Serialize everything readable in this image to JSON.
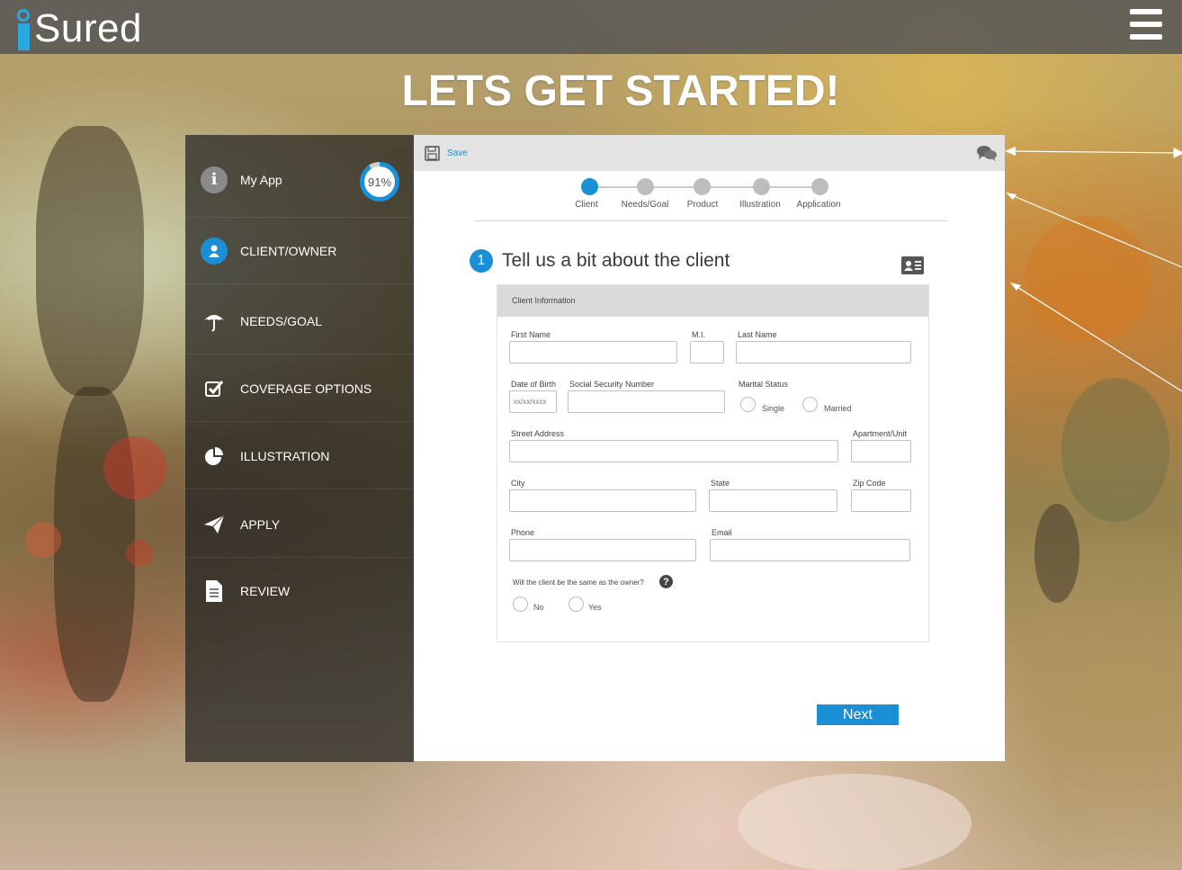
{
  "app": {
    "logo_text": "Sured"
  },
  "page": {
    "heading": "LETS GET STARTED!"
  },
  "sidebar": {
    "progress": {
      "value": 91,
      "label": "91%"
    },
    "items": [
      {
        "label": "My App",
        "icon": "info-icon"
      },
      {
        "label": "CLIENT/OWNER",
        "icon": "user-icon"
      },
      {
        "label": "NEEDS/GOAL",
        "icon": "umbrella-icon"
      },
      {
        "label": "COVERAGE OPTIONS",
        "icon": "checkbox-icon"
      },
      {
        "label": "ILLUSTRATION",
        "icon": "pie-chart-icon"
      },
      {
        "label": "APPLY",
        "icon": "paper-plane-icon"
      },
      {
        "label": "REVIEW",
        "icon": "document-icon"
      }
    ]
  },
  "toolbar": {
    "save_label": "Save"
  },
  "stepper": {
    "steps": [
      {
        "label": "Client",
        "active": true
      },
      {
        "label": "Needs/Goal",
        "active": false
      },
      {
        "label": "Product",
        "active": false
      },
      {
        "label": "Illustration",
        "active": false
      },
      {
        "label": "Application",
        "active": false
      }
    ]
  },
  "section": {
    "number": "1",
    "title": "Tell us a bit about the client"
  },
  "form": {
    "header": "Client Information",
    "first_name_label": "First Name",
    "mi_label": "M.I.",
    "last_name_label": "Last Name",
    "dob_label": "Date of Birth",
    "dob_placeholder": "xx/xx/xxxx",
    "ssn_label": "Social Security Number",
    "marital_label": "Marital Status",
    "marital_single": "Single",
    "marital_married": "Married",
    "street_label": "Street Address",
    "apt_label": "Apartment/Unit",
    "city_label": "City",
    "state_label": "State",
    "zip_label": "Zip Code",
    "phone_label": "Phone",
    "email_label": "Email",
    "same_owner_question": "Will the client be the same as the owner?",
    "same_owner_no": "No",
    "same_owner_yes": "Yes"
  },
  "actions": {
    "next_label": "Next"
  },
  "colors": {
    "accent": "#1a8fd6",
    "sidebar_bg": "#232323",
    "panel_bar": "#e3e3e3"
  }
}
